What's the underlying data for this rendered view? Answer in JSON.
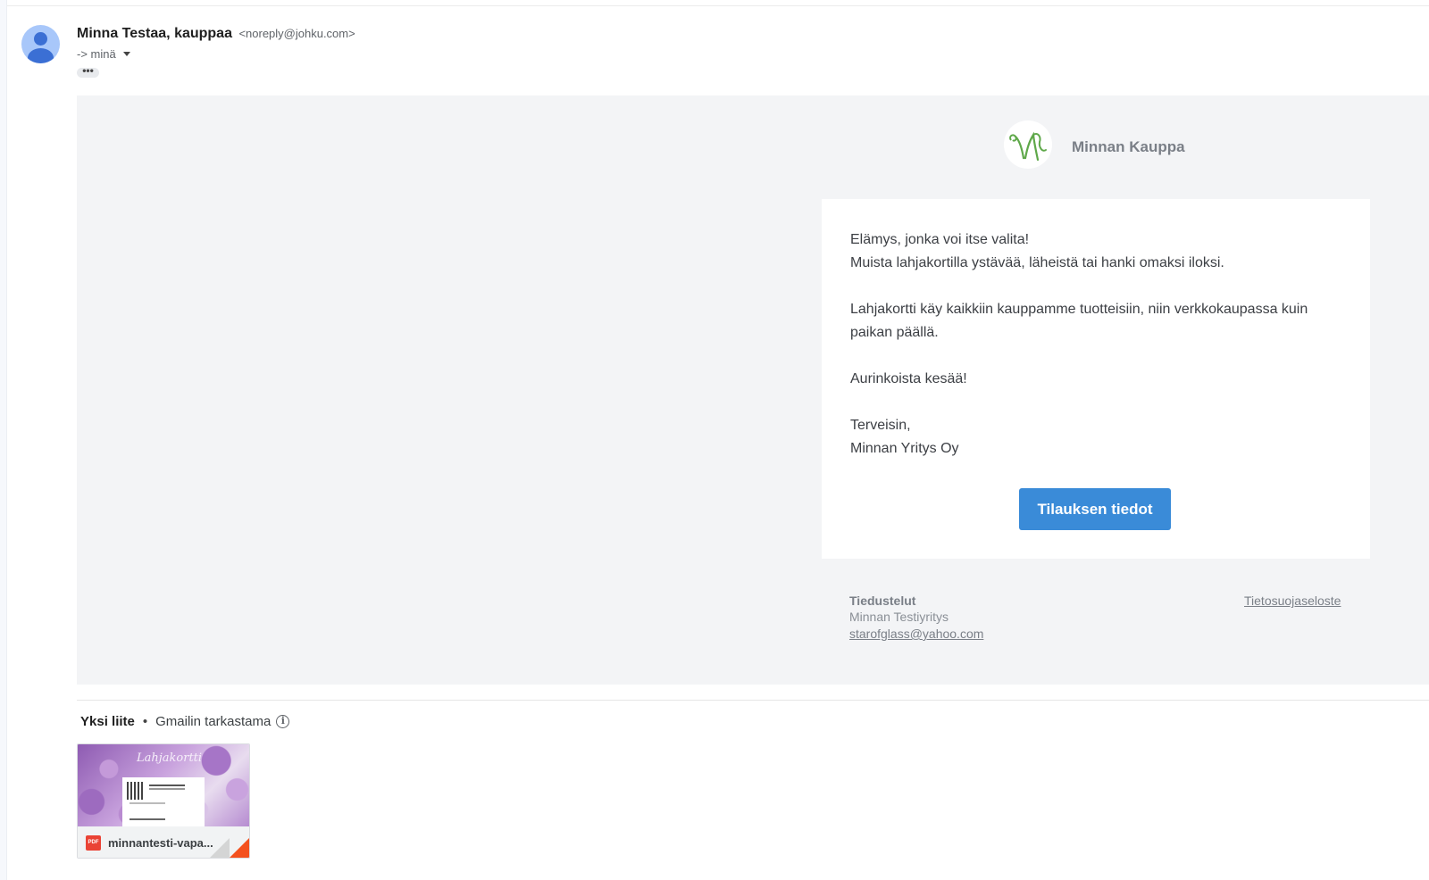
{
  "header": {
    "sender_name": "Minna Testaa, kauppaa",
    "sender_email": "<noreply@johku.com>",
    "recipient": "-> minä",
    "expand_dots": "•••"
  },
  "email": {
    "shop_name": "Minnan Kauppa",
    "logo_letter": "M",
    "message": {
      "line1": "Elämys, jonka voi itse valita!",
      "line2": "Muista lahjakortilla ystävää, läheistä tai hanki omaksi iloksi.",
      "line3": "Lahjakortti käy kaikkiin kauppamme tuotteisiin, niin verkkokaupassa kuin paikan päällä.",
      "line4": "Aurinkoista kesää!",
      "line5": "Terveisin,",
      "line6": "Minnan Yritys Oy"
    },
    "button_label": "Tilauksen tiedot",
    "footer": {
      "title": "Tiedustelut",
      "company": "Minnan Testiyritys",
      "email": "starofglass@yahoo.com",
      "privacy_link": "Tietosuojaseloste"
    }
  },
  "attachments": {
    "count_label": "Yksi liite",
    "separator": "•",
    "scan_label": "Gmailin tarkastama",
    "info_icon": "i",
    "items": [
      {
        "name": "minnantesti-vapa...",
        "type_badge": "PDF",
        "thumb_text": "Lahjakortti"
      }
    ]
  },
  "colors": {
    "button": "#3a8bd8",
    "email_bg": "#f3f4f6",
    "logo_green": "#5fa84a",
    "pdf_red": "#ea4335"
  }
}
